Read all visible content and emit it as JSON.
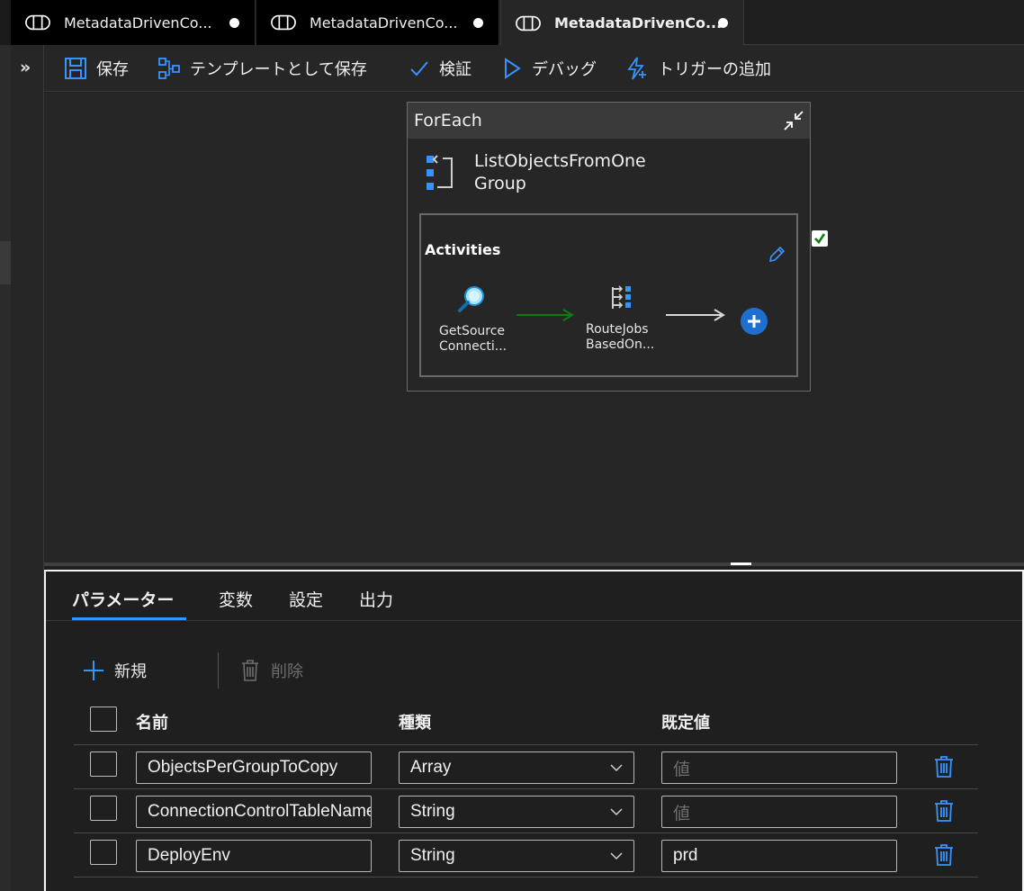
{
  "tabs": [
    {
      "label": "MetadataDrivenCo...",
      "modified": true,
      "active": false
    },
    {
      "label": "MetadataDrivenCo...",
      "modified": true,
      "active": false
    },
    {
      "label": "MetadataDrivenCo...",
      "modified": true,
      "active": true
    }
  ],
  "toolbar": {
    "save": "保存",
    "save_template": "テンプレートとして保存",
    "validate": "検証",
    "debug": "デバッグ",
    "add_trigger": "トリガーの追加"
  },
  "canvas": {
    "foreach": {
      "type_label": "ForEach",
      "name": "ListObjectsFromOneGroup",
      "activities_label": "Activities",
      "activities": [
        {
          "line1": "GetSource",
          "line2": "Connecti..."
        },
        {
          "line1": "RouteJobs",
          "line2": "BasedOn..."
        }
      ]
    }
  },
  "panel": {
    "tabs": [
      "パラメーター",
      "変数",
      "設定",
      "出力"
    ],
    "active_tab": "パラメーター",
    "new_label": "新規",
    "delete_label": "削除",
    "columns": {
      "name": "名前",
      "type": "種類",
      "default": "既定値"
    },
    "rows": [
      {
        "name": "ObjectsPerGroupToCopy",
        "type": "Array",
        "default": "",
        "default_placeholder": "値"
      },
      {
        "name": "ConnectionControlTableName",
        "type": "String",
        "default": "",
        "default_placeholder": "値"
      },
      {
        "name": "DeployEnv",
        "type": "String",
        "default": "prd",
        "default_placeholder": ""
      }
    ]
  },
  "colors": {
    "accent": "#3794ff",
    "success_arrow": "#107c10",
    "checkbox_green": "#107c10"
  }
}
